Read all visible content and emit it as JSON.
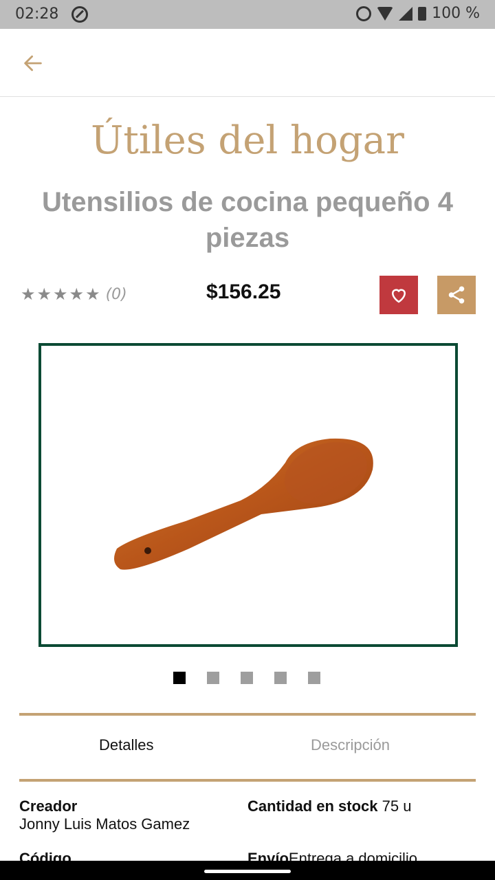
{
  "status_bar": {
    "time": "02:28",
    "battery": "100 %"
  },
  "header": {
    "category": "Útiles del hogar"
  },
  "product": {
    "title": "Utensilios de cocina pequeño 4 piezas",
    "rating_stars": 0,
    "rating_count": "(0)",
    "price": "$156.25"
  },
  "gallery": {
    "images": 5,
    "active_index": 0
  },
  "tabs": {
    "details": "Detalles",
    "description": "Descripción"
  },
  "details": {
    "creator_label": "Creador",
    "creator_value": "Jonny Luis Matos Gamez",
    "stock_label": "Cantidad en stock",
    "stock_value": "75 u",
    "code_label": "Código",
    "shipping_label": "Envío",
    "shipping_value": "Entrega a domicilio"
  },
  "colors": {
    "accent": "#c4a274",
    "favorite": "#c0393e",
    "share": "#c79a66",
    "frame": "#0c4a34"
  }
}
